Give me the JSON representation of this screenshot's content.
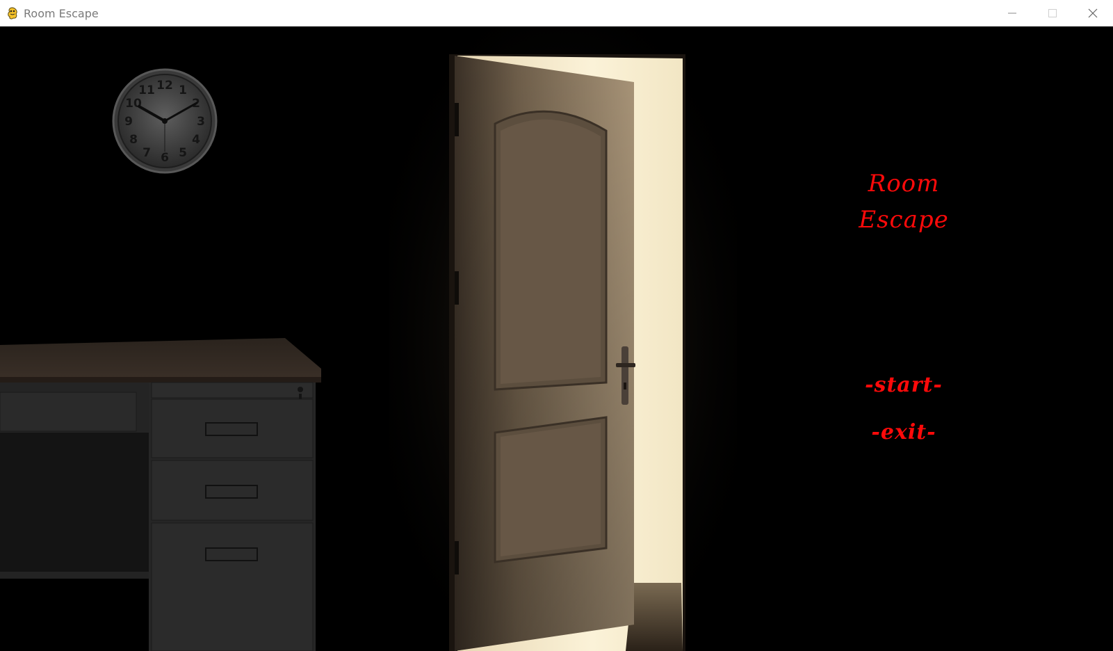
{
  "window": {
    "title": "Room Escape",
    "icon": "pygame-snake-icon",
    "controls": [
      "minimize-icon",
      "maximize-icon",
      "close-icon"
    ]
  },
  "game_menu": {
    "title_line1": "Room",
    "title_line2": "Escape",
    "start_label": "-start-",
    "exit_label": "-exit-",
    "text_color": "#ff0a0a"
  },
  "clock": {
    "numbers": [
      "12",
      "1",
      "2",
      "3",
      "4",
      "5",
      "6",
      "7",
      "8",
      "9",
      "10",
      "11"
    ]
  }
}
